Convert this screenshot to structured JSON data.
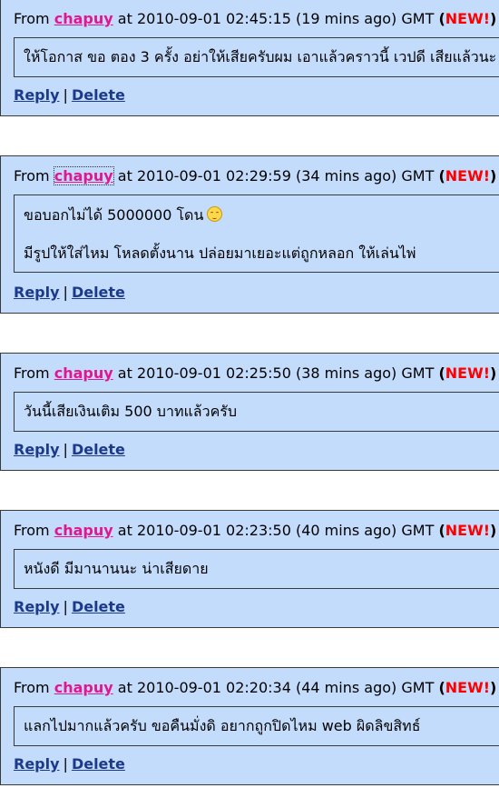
{
  "labels": {
    "from": "From",
    "at": "at",
    "gmt": "GMT",
    "new_open": "(",
    "new_word": "NEW!",
    "new_close": ")",
    "reply": "Reply",
    "delete": "Delete",
    "separator": "|"
  },
  "comments": [
    {
      "author": "chapuy",
      "timestamp": "2010-09-01 02:45:15",
      "ago": "(19 mins ago)",
      "lines": [
        "ให้โอกาส ขอ ตอง 3 ครั้ง อย่าให้เสียครับผม เอาแล้วคราวนี้ เวปดี เสียแล้วนะ"
      ]
    },
    {
      "author": "chapuy",
      "timestamp": "2010-09-01 02:29:59",
      "ago": "(34 mins ago)",
      "lines": [
        "ขอบอกไม่ได้ 5000000 โดน",
        "มีรูปให้ใส่ไหม โหลดตั้งนาน ปล่อยมาเยอะแต่ถูกหลอก ให้เล่นไพ่"
      ],
      "emoji": "blushing-smiley-icon"
    },
    {
      "author": "chapuy",
      "timestamp": "2010-09-01 02:25:50",
      "ago": "(38 mins ago)",
      "lines": [
        "วันนี้เสียเงินเติม 500 บาทแล้วครับ"
      ]
    },
    {
      "author": "chapuy",
      "timestamp": "2010-09-01 02:23:50",
      "ago": "(40 mins ago)",
      "lines": [
        "หนังดี มีมานานนะ น่าเสียดาย"
      ]
    },
    {
      "author": "chapuy",
      "timestamp": "2010-09-01 02:20:34",
      "ago": "(44 mins ago)",
      "lines": [
        "แลกไปมากแล้วครับ ขอคืนมั่งดิ อยากถูกปิดไหม web ผิดลิขสิทธ์"
      ]
    }
  ],
  "colors": {
    "panel_bg": "#c4dcfc",
    "author_link": "#e0178f",
    "action_link": "#1d3a8a",
    "new_badge": "#ff0000"
  }
}
